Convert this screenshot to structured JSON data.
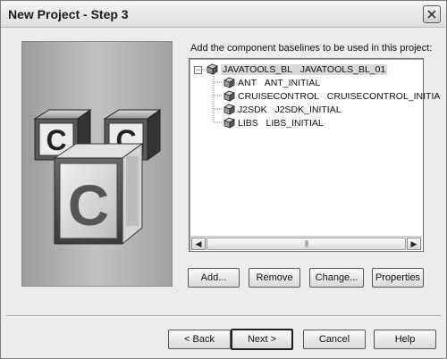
{
  "window": {
    "title": "New Project - Step 3"
  },
  "instruction": "Add the component baselines to be used in this project:",
  "tree": {
    "root": {
      "component": "JAVATOOLS_BL",
      "baseline": "JAVATOOLS_BL_01",
      "expanded": true
    },
    "children": [
      {
        "component": "ANT",
        "baseline": "ANT_INITIAL"
      },
      {
        "component": "CRUISECONTROL",
        "baseline": "CRUISECONTROL_INITIA"
      },
      {
        "component": "J2SDK",
        "baseline": "J2SDK_INITIAL"
      },
      {
        "component": "LIBS",
        "baseline": "LIBS_INITIAL"
      }
    ],
    "scrollbar_thumb_grip": "|||"
  },
  "actions": {
    "add": "Add...",
    "remove": "Remove",
    "change": "Change...",
    "properties": "Properties"
  },
  "nav": {
    "back": "< Back",
    "next": "Next >",
    "cancel": "Cancel",
    "help": "Help"
  },
  "art": {
    "letter": "C"
  },
  "colors": {
    "dialog_background": "#ececec",
    "tree_background": "#ffffff",
    "selection": "#d8d8d8"
  }
}
